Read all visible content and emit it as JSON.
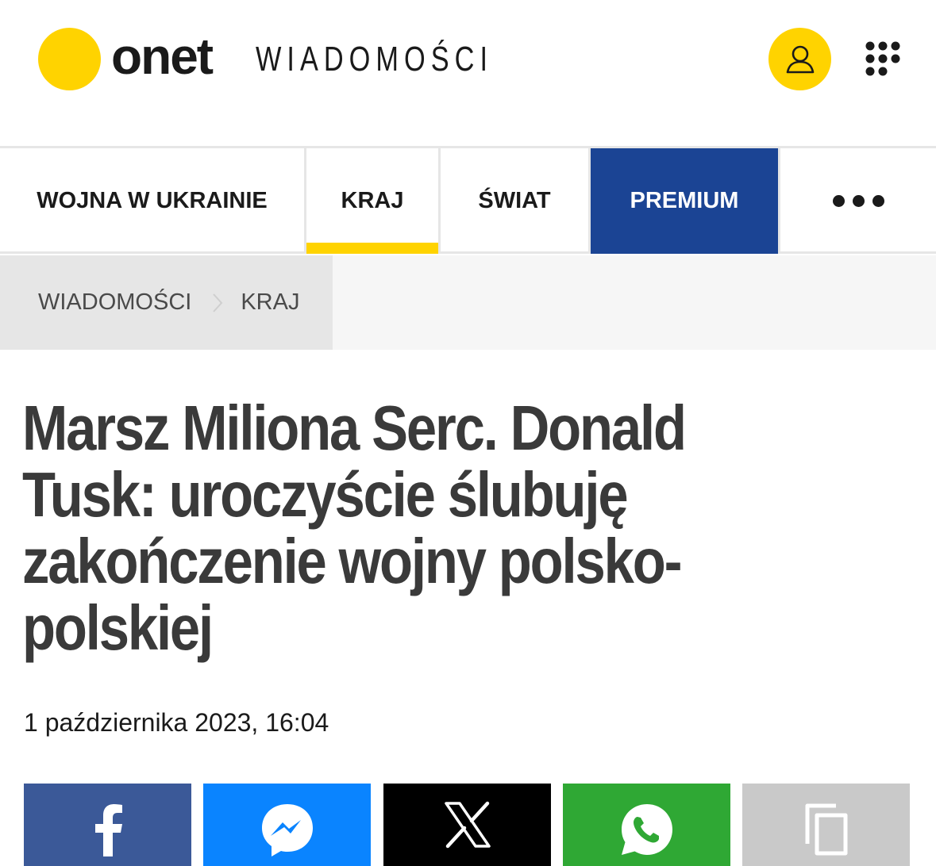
{
  "header": {
    "logo_text": "onet",
    "section_title": "WIADOMOŚCI",
    "user_icon": "user-icon",
    "apps_icon": "apps-grid-icon",
    "accent_color": "#ffd300"
  },
  "nav": {
    "items": [
      {
        "label": "WOJNA W UKRAINIE"
      },
      {
        "label": "KRAJ",
        "active": true
      },
      {
        "label": "ŚWIAT"
      },
      {
        "label": "PREMIUM",
        "highlight_color": "#1b4494"
      }
    ],
    "more_icon": "more-dots-icon"
  },
  "breadcrumb": {
    "items": [
      "WIADOMOŚCI",
      "KRAJ"
    ],
    "separator_icon": "chevron-right-icon"
  },
  "article": {
    "title": "Marsz Miliona Serc. Donald Tusk: uroczyście ślubuję zakończenie wojny polsko-polskiej",
    "date": "1 października 2023, 16:04"
  },
  "share": {
    "buttons": [
      {
        "icon": "facebook-icon",
        "color": "#3b5998"
      },
      {
        "icon": "messenger-icon",
        "color": "#0a84ff"
      },
      {
        "icon": "x-icon",
        "color": "#000000"
      },
      {
        "icon": "whatsapp-icon",
        "color": "#2fa834"
      },
      {
        "icon": "copy-icon",
        "color": "#c9c9c9"
      }
    ]
  }
}
